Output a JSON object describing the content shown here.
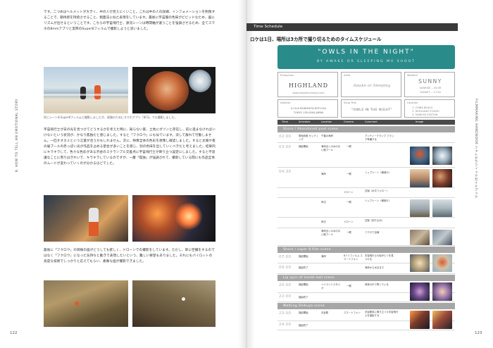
{
  "left_page": {
    "para1": "です。二つめはヘルメットが大きく、中の人が見えにくいこと。これは中の人の詳細、インフォメーションを制限することで、期待感を持続させること、側面法に似た表現をしています。最後に宇宙服の色味がビビッドなため、画にリズムが出せるということです。こちらの宇宙飛行士、源流シーンは時間軸が違うことを強調させるため、全てスマホの8mmアプリと実際のSuper8フィルムで撮影しようと思いました。",
    "caption": "同じシーンをSuper8フィルムと撮影しましたが、保険のためにスマホアプリ「8CS」でも撮影しました。",
    "para2": "宇宙飛行士が日の光を見つけてどうするかを考えた時に、知らない家、土地にポツンと存在し、前に進まなければいけないという状況が、かなり孤独だと感じました。すると「フクロウ」にも似ています。決して群れて行動しません。一匹オオカミという言葉が合うかもしれません。次に、映像全体の色彩を想像し確認しました。すると太陽や夜の展ブールの赤っぽい光が作品を占める割合が多いことを感じ、別の色味を出していくべきだと考えました。結果的にキラキラして、色々な色彩がある渋谷のスクランブル交差点に宇宙飛行士が降り立つ設定にしました。すると不思議なことに周りはきれいで、キラキラしているのですが、一層「孤独」が強調されて、撮影している間にも作品全体のムードが変わっていくのが分かるほどでした。",
    "para3": "最後に「フクロウ」の目線の画がどうしても欲しく、ドローンでの撮影をしています。ただし、単に空撮をするのではなく「フクロウ」になった気持ちと動きで表現したいという、難しい要望もありました。それにもパイロットの高度な技術でしっかりと応えてもらい、素敵な画が撮影できました。",
    "page_number": "122",
    "side_tab": "8. HOW TO TELL AN EMOTIONAL STORY"
  },
  "right_page": {
    "section_bar": "Time Schedule",
    "heading": "ロケは1日、場所は3カ所で撮り切るためのタイムスケジュール",
    "banner_title": "\"OWLS IN THE NIGHT\"",
    "banner_subtitle": "BY AWAKE OR SLEEPING MV SHOOT",
    "info": {
      "production_label": "Production",
      "production_value": "HIGHLAND",
      "production_url": "www.highland-tokyo.com",
      "artist_label": "Artist",
      "artist_value": "Awake or Sleeping",
      "weather_label": "Weather",
      "weather_value": "SUNNY",
      "sunrise": "SUNRISE -- 05:39",
      "sunset": "SUNSET -- 17:50",
      "address_label": "Address",
      "address_line1": "4-10-6 MORISHITA KOTO-KU",
      "address_line2": "TOKYO 135-0004 JAPAN",
      "song_label": "Song Title",
      "song_value": "\"OWLS IN THE NIGHT\"",
      "location_label": "Location",
      "location_1": "1. CHIBA BEACH",
      "location_2": "2. HIGHLAND STUDIO",
      "location_3": "3. SHIBUYA STATION"
    },
    "table_headers": [
      "Time",
      "Schedule",
      "Location",
      "Camera",
      "Comment",
      "Image"
    ],
    "sections": {
      "s1": "Shore / Abandoned pool scene",
      "s2": "Shore / super 8 film scene",
      "s3": "Lip sync of inside ball scene",
      "s4": "Walking Shibuya scene"
    },
    "rows": {
      "r1_time": "02:00",
      "r1_sched": "現地到着 セッティング",
      "r1_loc": "千葉の海岸",
      "r1_cam": "",
      "r1_comment": "アンティークランプ フラッグ準備する",
      "r1b_time": "03:00",
      "r1b_sched": "撮影開始",
      "r1b_loc": "海岸近くの水のない廃プール",
      "r1b_cam": "一眼",
      "r2_time": "04:30",
      "r2_loc": "海岸",
      "r2_cam": "一眼",
      "r2_comment": "リップシーン（朝焼け）",
      "r2b_cam": "ドローン",
      "r2b_comment": "空撮（水平フォロー）",
      "r2c_loc": "岸辺",
      "r2c_cam": "一眼",
      "r2c_comment": "リップシーン（朝焼け）",
      "r2d_loc": "岸辺",
      "r2d_cam": "ドローン",
      "r2d_comment": "空撮（回り込み）",
      "r2e_loc": "海岸近くの水のない廃プール",
      "r2e_cam": "一眼",
      "r2e_comment": "フクロウ目線",
      "r3_time": "07:00",
      "r3_sched": "撮影開始",
      "r3_loc": "海岸",
      "r3_cam": "8ミリフィルム スマートフォン",
      "r3_comment": "宇宙飛行士の仮がビンを見つける",
      "r3b_time": "09:00",
      "r3b_sched": "撮影終了",
      "r3b_comment": "海岸から水辺まで",
      "r4_time": "20:00",
      "r4_sched": "撮影開始",
      "r4_loc": "ハイランドスタジオ",
      "r4_cam": "一眼",
      "r4_comment": "球体の中で歌っている",
      "r4b_time": "22:00",
      "r4b_sched": "撮影終了",
      "r5_time": "23:00",
      "r5_sched": "撮影開始",
      "r5_loc": "渋谷駅",
      "r5_cam": "スマートフォン",
      "r5_comment": "渋谷駅前に降り立った宇宙飛行士を撮影する",
      "r5b_time": "24:00",
      "r5b_sched": "撮影終了"
    },
    "page_number": "123",
    "side_tab": "FILMMAKING HANDBOOK フォトグラフィックガイドブック"
  },
  "colors": {
    "banner": "#2a8c8a",
    "section_bar": "#3a3a3a",
    "table_header": "#4a4a4a",
    "section_row": "#a6a6a6"
  }
}
